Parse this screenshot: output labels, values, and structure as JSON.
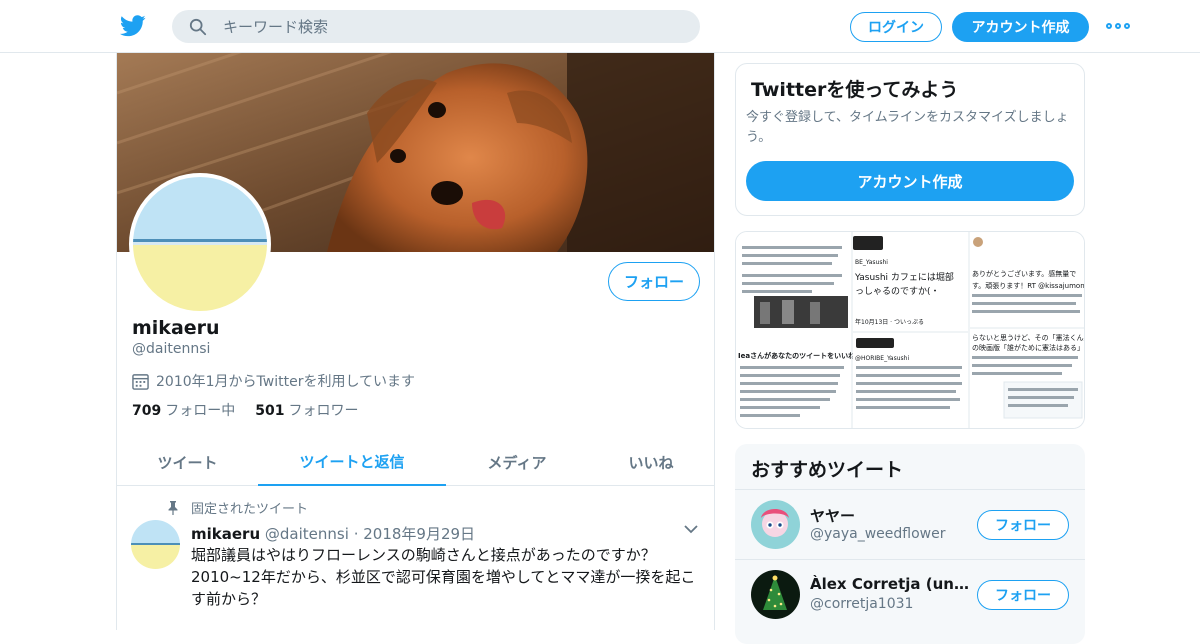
{
  "header": {
    "search_placeholder": "キーワード検索",
    "login_label": "ログイン",
    "signup_label": "アカウント作成"
  },
  "profile": {
    "name": "mikaeru",
    "handle": "@daitennsi",
    "joined": "2010年1月からTwitterを利用しています",
    "following_count": "709",
    "following_label": "フォロー中",
    "followers_count": "501",
    "followers_label": "フォロワー",
    "follow_label": "フォロー"
  },
  "tabs": [
    {
      "label": "ツイート",
      "active": false
    },
    {
      "label": "ツイートと返信",
      "active": true
    },
    {
      "label": "メディア",
      "active": false
    },
    {
      "label": "いいね",
      "active": false
    }
  ],
  "pinned_tweet": {
    "pinned_label": "固定されたツイート",
    "name": "mikaeru",
    "handle": "@daitennsi",
    "date": "2018年9月29日",
    "text": "堀部議員はやはりフローレンスの駒崎さんと接点があったのですか？\n2010~12年だから、杉並区で認可保育園を増やしてとママ達が一揆を起こす前から？\n\n堀部議員が私をブロックしたのはこのツイートを見られたくなかったか"
  },
  "signup_card": {
    "title": "Twitterを使ってみよう",
    "description": "今すぐ登録して、タイムラインをカスタマイズしましょう。",
    "button_label": "アカウント作成"
  },
  "recommended": {
    "title": "おすすめツイート",
    "accounts": [
      {
        "name": "ヤヤー",
        "handle": "@yaya_weedflower",
        "follow_label": "フォロー"
      },
      {
        "name": "Àlex Corretja (una g…",
        "handle": "@corretja1031",
        "follow_label": "フォロー"
      }
    ]
  },
  "media_thumbs": {
    "left_header_text": "Ieaさんがあなたのツイートをいいねしま",
    "middle_top_text": "Yasushi カフェには堀部",
    "middle_top_text2": "っしゃるのですか(・",
    "middle_handle": "@HORIBE_Yasushi",
    "middle_date": "年10月13日 · ついっぷる",
    "right_top_text": "ありがとうございます。感無量で",
    "right_top_text2": "す。頑張ります！RT @kissajumon",
    "right_mid_text": "らないと思うけど、その「憲法くん」",
    "right_mid_text2": "の映画版「誰がために憲法はある」を"
  },
  "colors": {
    "accent": "#1da1f2",
    "text_primary": "#14171a",
    "text_secondary": "#657786",
    "border": "#e1e8ed"
  },
  "icons": [
    "twitter-logo-icon",
    "search-icon",
    "more-icon",
    "calendar-icon",
    "pin-icon",
    "chevron-down-icon"
  ]
}
